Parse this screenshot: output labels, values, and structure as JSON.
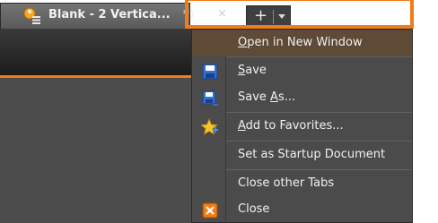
{
  "tab": {
    "title": "Blank - 2 Vertica...",
    "title_suffix": "*)",
    "close_glyph": "×",
    "icon": "document-people-icon"
  },
  "tab_controls": {
    "new_tab_glyph": "+",
    "dropdown_icon": "chevron-down-icon"
  },
  "menu": {
    "items": [
      {
        "id": "open-new-window",
        "pre": "",
        "mnemonic": "O",
        "post": "pen in New Window",
        "icon": ""
      },
      {
        "id": "save",
        "pre": "",
        "mnemonic": "S",
        "post": "ave",
        "icon": "floppy-disk-icon"
      },
      {
        "id": "save-as",
        "pre": "Save ",
        "mnemonic": "A",
        "post": "s...",
        "icon": "floppy-disk-saveas-icon"
      },
      {
        "id": "add-favorites",
        "pre": "",
        "mnemonic": "A",
        "post": "dd to Favorites...",
        "icon": "star-add-icon"
      },
      {
        "id": "set-startup",
        "pre": "Set as Startup Document",
        "mnemonic": "",
        "post": "",
        "icon": ""
      },
      {
        "id": "close-other-tabs",
        "pre": "Close other Tabs",
        "mnemonic": "",
        "post": "",
        "icon": ""
      },
      {
        "id": "close",
        "pre": "Close",
        "mnemonic": "",
        "post": "",
        "icon": "close-x-icon"
      }
    ]
  },
  "colors": {
    "accent": "#f07c1a",
    "menu_bg": "#4b4b4b",
    "highlight": "#5e4a36",
    "text": "#f0f0f0"
  }
}
